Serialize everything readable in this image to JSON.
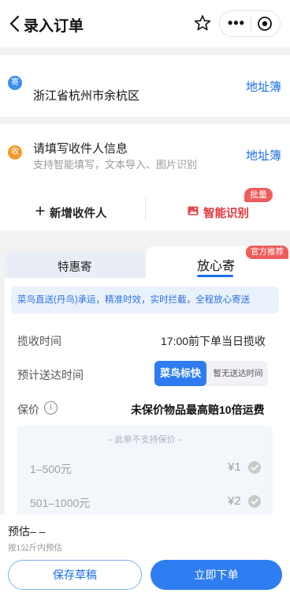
{
  "header": {
    "title": "录入订单"
  },
  "sender": {
    "badge": "寄",
    "address": "浙江省杭州市余杭区",
    "link": "地址簿"
  },
  "receiver": {
    "badge": "收",
    "title": "请填写收件人信息",
    "subtitle": "支持智能填写，文本导入、图片识别",
    "link": "地址簿"
  },
  "actions": {
    "add_label": "新增收件人",
    "smart_label": "智能识别",
    "smart_tag": "批量"
  },
  "service": {
    "tabs": [
      "特惠寄",
      "放心寄"
    ],
    "active_tab": 1,
    "recommend_tag": "官方推荐",
    "notice": "菜鸟直送(丹鸟)承运，精准时效，实时拦截，全程放心寄送",
    "pickup_label": "揽收时间",
    "pickup_value": "17:00前下单当日揽收",
    "delivery_label": "预计送达时间",
    "delivery_options": [
      "菜鸟标快",
      "暂无送达时间"
    ],
    "insurance_label": "保价",
    "insurance_value": "未保价物品最高赔10倍运费",
    "insurance_note": "– 此单不支持保价 –",
    "insurance_rows": [
      {
        "range": "1–500元",
        "price": "¥1"
      },
      {
        "range": "501–1000元",
        "price": "¥2"
      }
    ]
  },
  "footer": {
    "estimate": "预估– –",
    "estimate_note": "按1公斤内预估",
    "draft_button": "保存草稿",
    "submit_button": "立即下单"
  },
  "colors": {
    "accent": "#1a6fe8",
    "sender_badge": "#3d8ef0",
    "receiver_badge": "#f39a2b",
    "tag_red": "#f05b5b"
  }
}
